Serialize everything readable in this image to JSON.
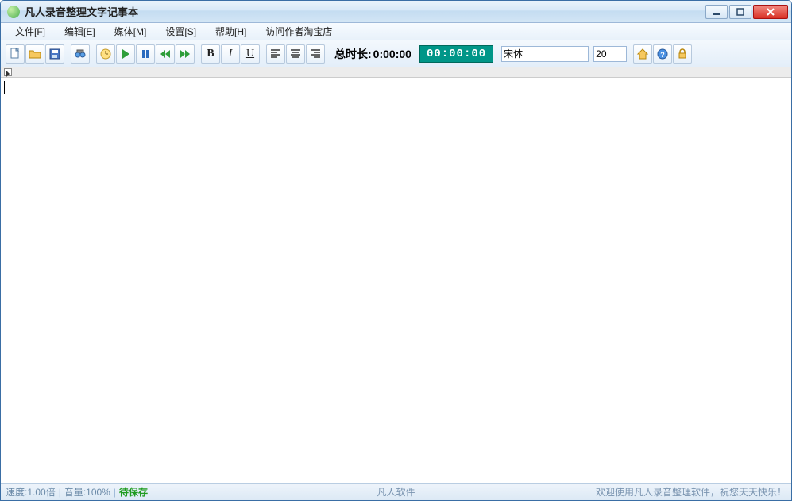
{
  "window": {
    "title": "凡人录音整理文字记事本"
  },
  "menu": {
    "file": "文件[F]",
    "edit": "编辑[E]",
    "media": "媒体[M]",
    "settings": "设置[S]",
    "help": "帮助[H]",
    "visit_shop": "访问作者淘宝店"
  },
  "toolbar": {
    "total_length_label": "总时长:",
    "total_length_value": "0:00:00",
    "timecode": "00:00:00",
    "font_name": "宋体",
    "font_size": "20",
    "fmt_bold": "B",
    "fmt_italic": "I",
    "fmt_underline": "U"
  },
  "icons": {
    "new": "new-file-icon",
    "open": "open-folder-icon",
    "save": "save-disk-icon",
    "find": "binoculars-icon",
    "stamp": "timestamp-icon",
    "play": "play-icon",
    "pause": "pause-icon",
    "rewind": "rewind-icon",
    "forward": "forward-icon",
    "align_left": "align-left-icon",
    "align_center": "align-center-icon",
    "align_right": "align-right-icon",
    "home": "home-icon",
    "help": "help-icon",
    "lock": "lock-icon"
  },
  "status": {
    "speed": "速度:1.00倍",
    "volume": "音量:100%",
    "pending_save": "待保存",
    "brand": "凡人软件",
    "greeting": "欢迎使用凡人录音整理软件，祝您天天快乐！"
  }
}
